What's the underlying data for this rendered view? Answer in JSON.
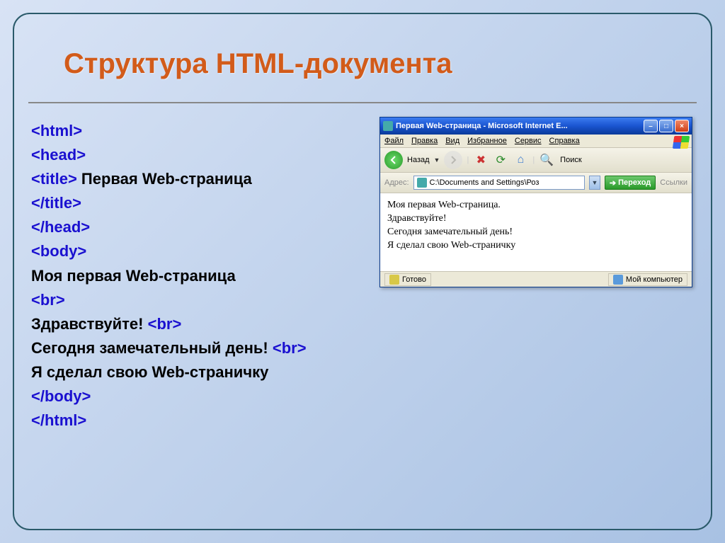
{
  "slide": {
    "title": "Структура HTML-документа"
  },
  "code": {
    "l1": "<html>",
    "l2": "<head>",
    "l3a": "<title>",
    "l3b": " Первая  Web-страница",
    "l4": "</title>",
    "l5": "</head>",
    "l6": "<body>",
    "l7": "Моя первая Web-страница",
    "l8": "<br>",
    "l9a": "Здравствуйте! ",
    "l9b": "<br>",
    "l10a": "Сегодня замечательный день! ",
    "l10b": "<br>",
    "l11": "Я сделал свою Web-страничку",
    "l12": "</body>",
    "l13": "</html>"
  },
  "browser": {
    "title": "Первая Web-страница - Microsoft Internet E...",
    "menu": {
      "file": "Файл",
      "edit": "Правка",
      "view": "Вид",
      "favorites": "Избранное",
      "tools": "Сервис",
      "help": "Справка"
    },
    "toolbar": {
      "back": "Назад",
      "search": "Поиск"
    },
    "address": {
      "label": "Адрес:",
      "value": "C:\\Documents and Settings\\Роз",
      "go": "Переход",
      "links": "Ссылки"
    },
    "content": {
      "l1": "Моя первая Web-страница.",
      "l2": "Здравствуйте!",
      "l3": "Сегодня замечательный день!",
      "l4": "Я сделал свою Web-страничку"
    },
    "status": {
      "ready": "Готово",
      "zone": "Мой компьютер"
    }
  }
}
